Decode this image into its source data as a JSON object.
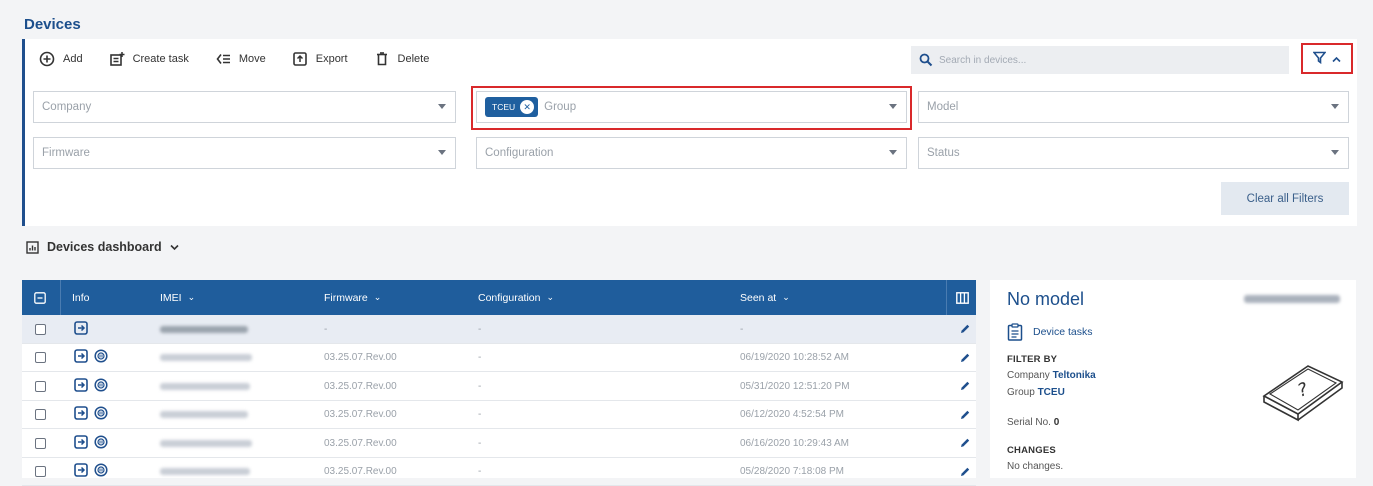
{
  "page": {
    "title": "Devices"
  },
  "toolbar": {
    "add": "Add",
    "create_task": "Create task",
    "move": "Move",
    "export": "Export",
    "delete": "Delete",
    "search_placeholder": "Search in devices..."
  },
  "filters": {
    "company": "Company",
    "group": "Group",
    "group_chip": "TCEU",
    "model": "Model",
    "firmware": "Firmware",
    "configuration": "Configuration",
    "status": "Status",
    "clear_all": "Clear all Filters"
  },
  "dashboard": {
    "label": "Devices dashboard"
  },
  "table": {
    "headers": {
      "info": "Info",
      "imei": "IMEI",
      "firmware": "Firmware",
      "configuration": "Configuration",
      "seen_at": "Seen at"
    },
    "rows": [
      {
        "firmware": "-",
        "configuration": "-",
        "seen_at": "-",
        "has_second_icon": false
      },
      {
        "firmware": "03.25.07.Rev.00",
        "configuration": "-",
        "seen_at": "06/19/2020 10:28:52 AM",
        "has_second_icon": true
      },
      {
        "firmware": "03.25.07.Rev.00",
        "configuration": "-",
        "seen_at": "05/31/2020 12:51:20 PM",
        "has_second_icon": true
      },
      {
        "firmware": "03.25.07.Rev.00",
        "configuration": "-",
        "seen_at": "06/12/2020 4:52:54 PM",
        "has_second_icon": true
      },
      {
        "firmware": "03.25.07.Rev.00",
        "configuration": "-",
        "seen_at": "06/16/2020 10:29:43 AM",
        "has_second_icon": true
      },
      {
        "firmware": "03.25.07.Rev.00",
        "configuration": "-",
        "seen_at": "05/28/2020 7:18:08 PM",
        "has_second_icon": true
      }
    ]
  },
  "side": {
    "title": "No model",
    "device_tasks": "Device tasks",
    "filter_by": "FILTER BY",
    "company_label": "Company",
    "company_value": "Teltonika",
    "group_label": "Group",
    "group_value": "TCEU",
    "serial_label": "Serial No.",
    "serial_value": "0",
    "changes_label": "CHANGES",
    "changes_value": "No changes."
  },
  "colors": {
    "accent": "#1f5d9c",
    "highlight": "#d9292b"
  }
}
